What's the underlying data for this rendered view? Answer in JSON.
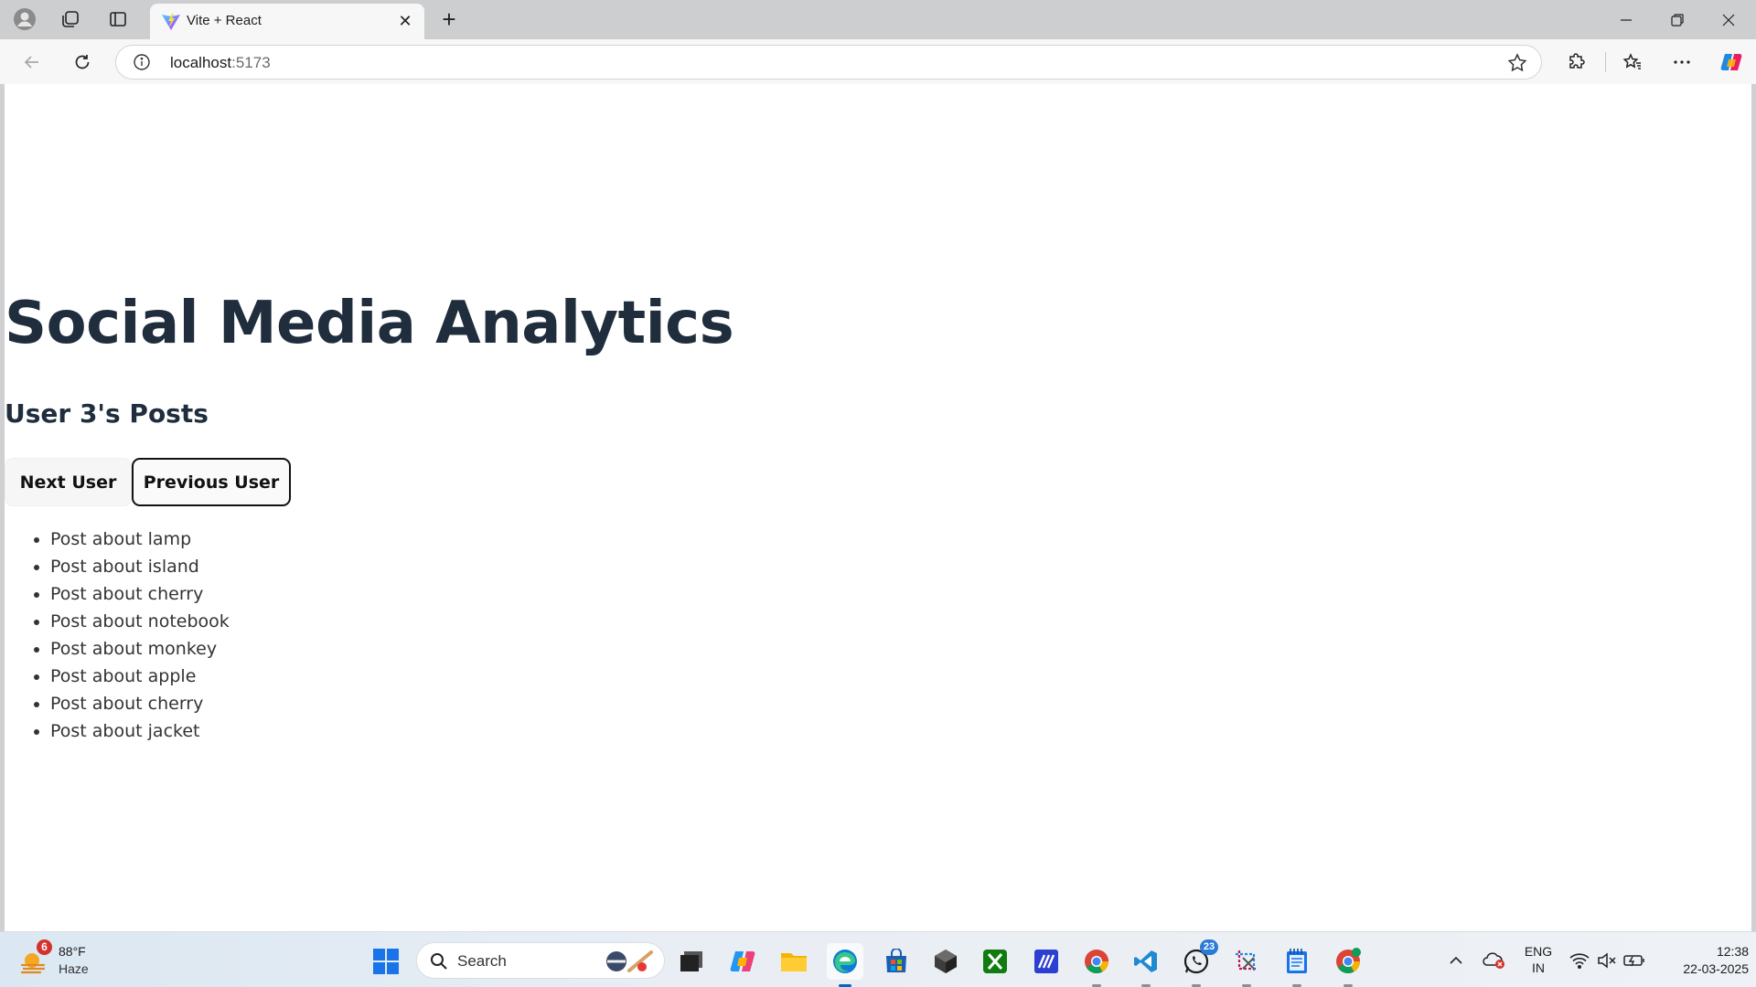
{
  "browser": {
    "tab": {
      "title": "Vite + React"
    },
    "address": {
      "host": "localhost",
      "port": ":5173"
    }
  },
  "page": {
    "title": "Social Media Analytics",
    "subtitle": "User 3's Posts",
    "buttons": {
      "next": "Next User",
      "previous": "Previous User"
    },
    "posts": [
      "Post about lamp",
      "Post about island",
      "Post about cherry",
      "Post about notebook",
      "Post about monkey",
      "Post about apple",
      "Post about cherry",
      "Post about jacket"
    ]
  },
  "taskbar": {
    "weather": {
      "badge": "6",
      "temp": "88°F",
      "condition": "Haze"
    },
    "search": {
      "placeholder": "Search"
    },
    "whatsapp_badge": "23",
    "language": {
      "line1": "ENG",
      "line2": "IN"
    },
    "clock": {
      "time": "12:38",
      "date": "22-03-2025"
    }
  },
  "colors": {
    "heading": "#1f2d3d",
    "accent": "#0067c0",
    "badge_red": "#d4312c"
  }
}
